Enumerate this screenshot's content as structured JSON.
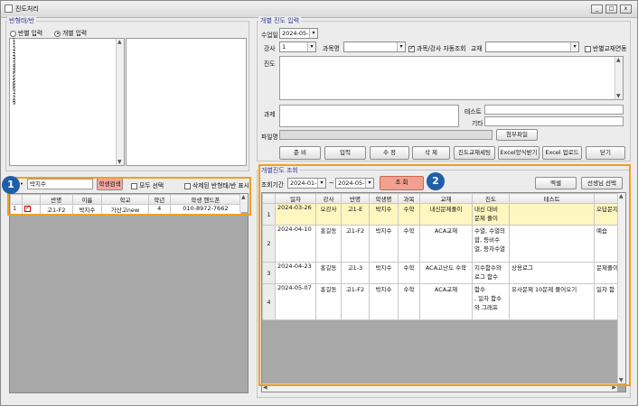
{
  "window": {
    "title": "진도처리",
    "min": "_",
    "max": "□",
    "close": "x"
  },
  "left": {
    "group_label": "반형태/반",
    "radio_class": "반별 입력",
    "radio_individual": "개별 입력",
    "list_items": [
      "1",
      "1",
      "1",
      "2",
      "2",
      "2",
      "3",
      "3",
      "3",
      "4",
      "4",
      "4",
      "5",
      "5",
      "5",
      "6",
      "6",
      "6",
      "7",
      "7",
      "7",
      "8",
      "9"
    ]
  },
  "search": {
    "value": "박지수",
    "search_button": "학생검색",
    "all_select": "모두 선택",
    "deleted_show": "삭제된 반형태/반 표시"
  },
  "student_grid": {
    "headers": [
      "",
      "",
      "반명",
      "이름",
      "학교",
      "학년",
      "학생 핸드폰"
    ],
    "rows": [
      [
        "1",
        "",
        "고1-F2",
        "박지수",
        "가산고new",
        "4",
        "010-8972-7662"
      ]
    ]
  },
  "entry": {
    "group_label": "개별 진도 입력",
    "date_label": "수업일",
    "date_value": "2024-05-08",
    "teacher_label": "강사",
    "teacher_value": "1",
    "subject_label": "과목명",
    "auto_label": "과목/강사 자동조회",
    "textbook_label": "교재",
    "class_textbook_label": "반별교재연동",
    "progress_label": "진도",
    "homework_label": "과제",
    "test_label": "테스트",
    "etc_label": "기타",
    "file_label": "파일명",
    "attach_button": "첨부파일"
  },
  "actions": [
    "준 비",
    "입력",
    "수 정",
    "삭 제",
    "진도교재세팅",
    "Excel양식받기",
    "Excel 업로드",
    "닫기"
  ],
  "query": {
    "group_label": "개별진도 조회",
    "period_label": "조회기간",
    "from": "2024-01-01",
    "sep": "~",
    "to": "2024-05-08",
    "search_button": "조 회",
    "excel_button": "엑셀",
    "teacher_select_button": "선생님 선택"
  },
  "progress_grid": {
    "headers": [
      "",
      "일자",
      "강사",
      "반명",
      "학생명",
      "과목",
      "교재",
      "진도",
      "테스트",
      ""
    ],
    "rows": [
      [
        "1",
        "2024-03-26",
        "오강사",
        "고1-E",
        "박지수",
        "수학",
        "내신문제풀이",
        "내신 대비\n문제 풀이",
        "",
        "오답문지"
      ],
      [
        "2",
        "2024-04-10",
        "홍길동",
        "고1-F2",
        "박지수",
        "수학",
        "ACA교재",
        "수열, 수열의\n합, 등비수\n열, 등차수열",
        "",
        "예습"
      ],
      [
        "3",
        "2024-04-23",
        "홍길동",
        "고1-3",
        "박지수",
        "수학",
        "ACA고난도 수학",
        "지수함수와\n로그 함수",
        "상용로그",
        "문제풀이"
      ],
      [
        "4",
        "2024-05-07",
        "홍길동",
        "고1-F2",
        "박지수",
        "수학",
        "ACA교재",
        "함수\n, 일차 함수\n와 그래프",
        "유사문제 10문제 풀어오기",
        "일차 함"
      ]
    ]
  },
  "annotations": {
    "badge1": "1",
    "badge2": "2"
  },
  "colors": {
    "highlight": "#f0a020",
    "badge": "#1f5fa8",
    "selected_row": "#fdf6c0",
    "search_btn": "#f2a8a0"
  }
}
